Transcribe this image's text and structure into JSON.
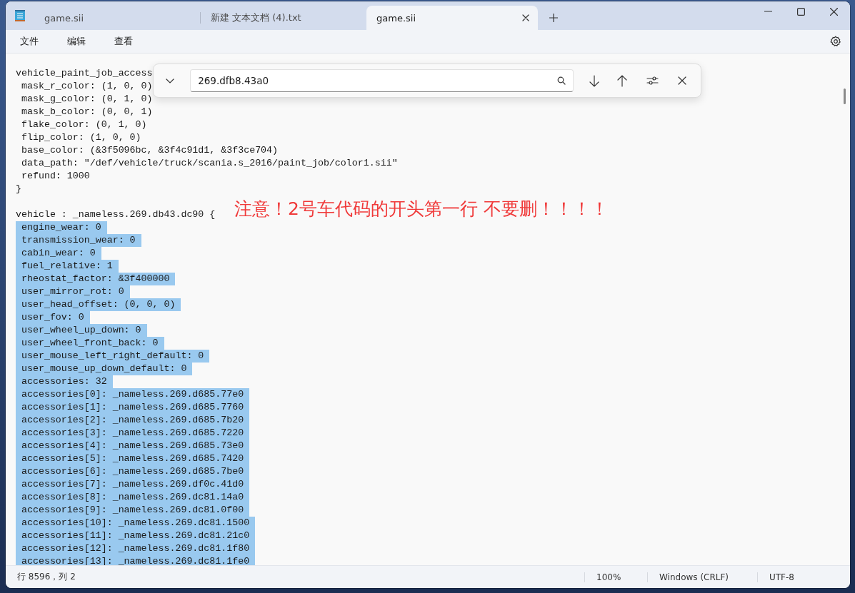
{
  "tabs": [
    {
      "label": "game.sii",
      "selected": false
    },
    {
      "label": "新建 文本文档 (4).txt",
      "selected": false
    },
    {
      "label": "game.sii",
      "selected": true
    }
  ],
  "menu": [
    "文件",
    "编辑",
    "查看"
  ],
  "find": {
    "value": "269.dfb8.43a0"
  },
  "lines": [
    {
      "kind": "text",
      "text": "vehicle_paint_job_access",
      "selected": false
    },
    {
      "kind": "text",
      "text": " mask_r_color: (1, 0, 0)",
      "selected": false
    },
    {
      "kind": "text",
      "text": " mask_g_color: (0, 1, 0)",
      "selected": false
    },
    {
      "kind": "text",
      "text": " mask_b_color: (0, 0, 1)",
      "selected": false
    },
    {
      "kind": "text",
      "text": " flake_color: (0, 1, 0)",
      "selected": false
    },
    {
      "kind": "text",
      "text": " flip_color: (1, 0, 0)",
      "selected": false
    },
    {
      "kind": "text",
      "text": " base_color: (&3f5096bc, &3f4c91d1, &3f3ce704)",
      "selected": false
    },
    {
      "kind": "text",
      "text": " data_path: \"/def/vehicle/truck/scania.s_2016/paint_job/color1.sii\"",
      "selected": false
    },
    {
      "kind": "text",
      "text": " refund: 1000",
      "selected": false
    },
    {
      "kind": "text",
      "text": "}",
      "selected": false
    },
    {
      "kind": "blank"
    },
    {
      "kind": "text",
      "text": "vehicle : _nameless.269.db43.dc90 {",
      "selected": false
    },
    {
      "kind": "text",
      "text": " engine_wear: 0",
      "selected": true
    },
    {
      "kind": "text",
      "text": " transmission_wear: 0",
      "selected": true
    },
    {
      "kind": "text",
      "text": " cabin_wear: 0",
      "selected": true
    },
    {
      "kind": "text",
      "text": " fuel_relative: 1",
      "selected": true
    },
    {
      "kind": "text",
      "text": " rheostat_factor: &3f400000",
      "selected": true
    },
    {
      "kind": "text",
      "text": " user_mirror_rot: 0",
      "selected": true
    },
    {
      "kind": "text",
      "text": " user_head_offset: (0, 0, 0)",
      "selected": true
    },
    {
      "kind": "text",
      "text": " user_fov: 0",
      "selected": true
    },
    {
      "kind": "text",
      "text": " user_wheel_up_down: 0",
      "selected": true
    },
    {
      "kind": "text",
      "text": " user_wheel_front_back: 0",
      "selected": true
    },
    {
      "kind": "text",
      "text": " user_mouse_left_right_default: 0",
      "selected": true
    },
    {
      "kind": "text",
      "text": " user_mouse_up_down_default: 0",
      "selected": true
    },
    {
      "kind": "text",
      "text": " accessories: 32",
      "selected": true
    },
    {
      "kind": "text",
      "text": " accessories[0]: _nameless.269.d685.77e0",
      "selected": true
    },
    {
      "kind": "text",
      "text": " accessories[1]: _nameless.269.d685.7760",
      "selected": true
    },
    {
      "kind": "text",
      "text": " accessories[2]: _nameless.269.d685.7b20",
      "selected": true
    },
    {
      "kind": "text",
      "text": " accessories[3]: _nameless.269.d685.7220",
      "selected": true
    },
    {
      "kind": "text",
      "text": " accessories[4]: _nameless.269.d685.73e0",
      "selected": true
    },
    {
      "kind": "text",
      "text": " accessories[5]: _nameless.269.d685.7420",
      "selected": true
    },
    {
      "kind": "text",
      "text": " accessories[6]: _nameless.269.d685.7be0",
      "selected": true
    },
    {
      "kind": "text",
      "text": " accessories[7]: _nameless.269.df0c.41d0",
      "selected": true
    },
    {
      "kind": "text",
      "text": " accessories[8]: _nameless.269.dc81.14a0",
      "selected": true
    },
    {
      "kind": "text",
      "text": " accessories[9]: _nameless.269.dc81.0f00",
      "selected": true
    },
    {
      "kind": "text",
      "text": " accessories[10]: _nameless.269.dc81.1500",
      "selected": true
    },
    {
      "kind": "text",
      "text": " accessories[11]: _nameless.269.dc81.21c0",
      "selected": true
    },
    {
      "kind": "text",
      "text": " accessories[12]: _nameless.269.dc81.1f80",
      "selected": true
    },
    {
      "kind": "text",
      "text": " accessories[13]: _nameless.269.dc81.1fe0",
      "selected": true
    }
  ],
  "annotation": "注意！2号车代码的开头第一行 不要删！！！！",
  "status_bar": {
    "position": "行 8596，列 2",
    "zoom": "100%",
    "line_ending": "Windows (CRLF)",
    "encoding": "UTF-8"
  }
}
